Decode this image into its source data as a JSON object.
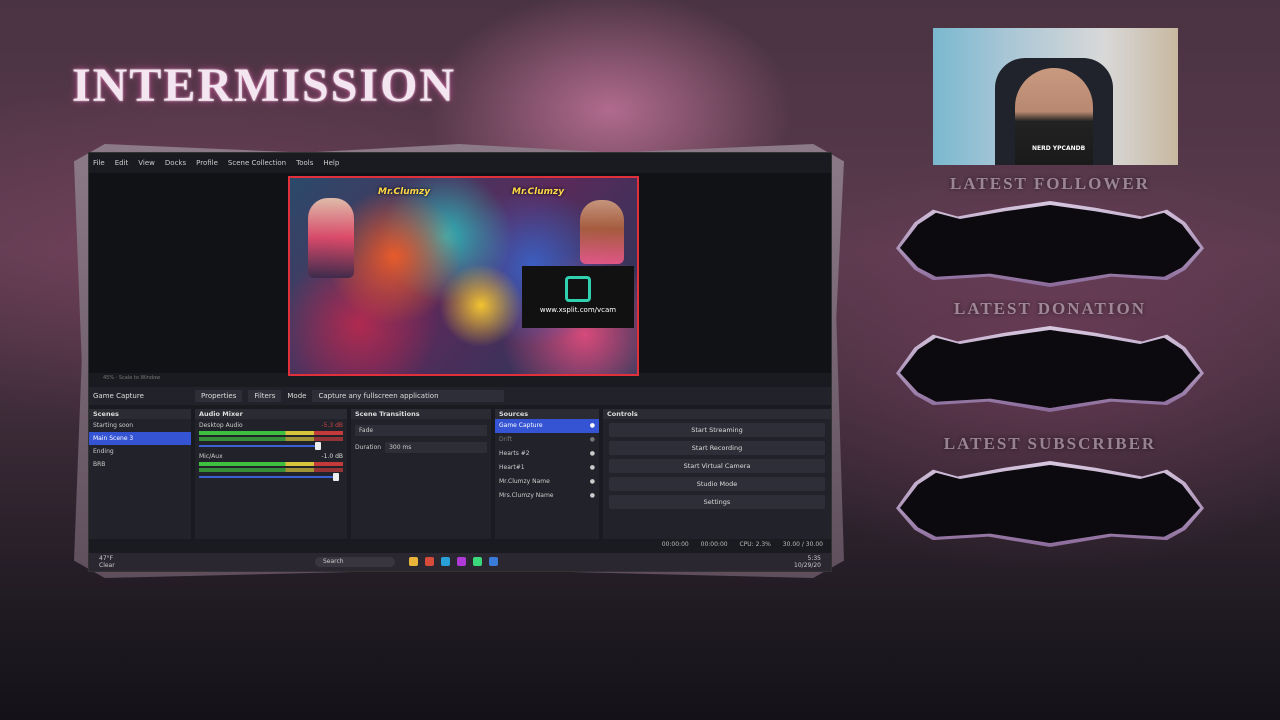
{
  "overlay": {
    "title": "INTERMISSION",
    "labels": {
      "follower": "LATEST FOLLOWER",
      "donation": "LATEST DONATION",
      "subscriber": "LATEST SUBSCRIBER"
    },
    "webcam": {
      "shirt_text": "NERD YPCANDB"
    },
    "accent_color": "#b24a86"
  },
  "obs": {
    "menu": [
      "File",
      "Edit",
      "View",
      "Docks",
      "Profile",
      "Scene Collection",
      "Tools",
      "Help"
    ],
    "preview": {
      "tag_left": "Mr.Clumzy",
      "tag_right": "Mr.Clumzy",
      "vcam_url": "www.xsplit.com/vcam",
      "zoom_label": "45%  ·  Scale to Window"
    },
    "toolbar": {
      "source_name": "Game Capture",
      "properties": "Properties",
      "filters": "Filters",
      "mode_label": "Mode",
      "mode_value": "Capture any fullscreen application"
    },
    "scenes": {
      "header": "Scenes",
      "items": [
        "Starting soon",
        "Main Scene 3",
        "Ending",
        "BRB"
      ],
      "selected_index": 1
    },
    "mixer": {
      "header": "Audio Mixer",
      "channels": [
        {
          "name": "Desktop Audio",
          "db": "-5.3 dB",
          "volume": 0.85
        },
        {
          "name": "Mic/Aux",
          "db": "-1.0 dB",
          "volume": 0.97
        }
      ]
    },
    "transitions": {
      "header": "Scene Transitions",
      "type": "Fade",
      "duration_label": "Duration",
      "duration_value": "300 ms"
    },
    "sources": {
      "header": "Sources",
      "items": [
        {
          "name": "Game Capture",
          "selected": true,
          "dim": false
        },
        {
          "name": "Drift",
          "selected": false,
          "dim": true
        },
        {
          "name": "Hearts #2",
          "selected": false,
          "dim": false
        },
        {
          "name": "Heart#1",
          "selected": false,
          "dim": false
        },
        {
          "name": "Mr.Clumzy Name",
          "selected": false,
          "dim": false
        },
        {
          "name": "Mrs.Clumzy Name",
          "selected": false,
          "dim": false
        }
      ]
    },
    "controls": {
      "header": "Controls",
      "buttons": [
        "Start Streaming",
        "Start Recording",
        "Start Virtual Camera",
        "Studio Mode",
        "Settings"
      ]
    },
    "status": {
      "stream_time": "00:00:00",
      "rec_time": "00:00:00",
      "cpu": "CPU: 2.3%",
      "fps": "30.00 / 30.00"
    },
    "taskbar": {
      "weather_temp": "47°F",
      "weather_desc": "Clear",
      "search": "Search",
      "time": "5:35",
      "date": "10/29/20"
    }
  }
}
